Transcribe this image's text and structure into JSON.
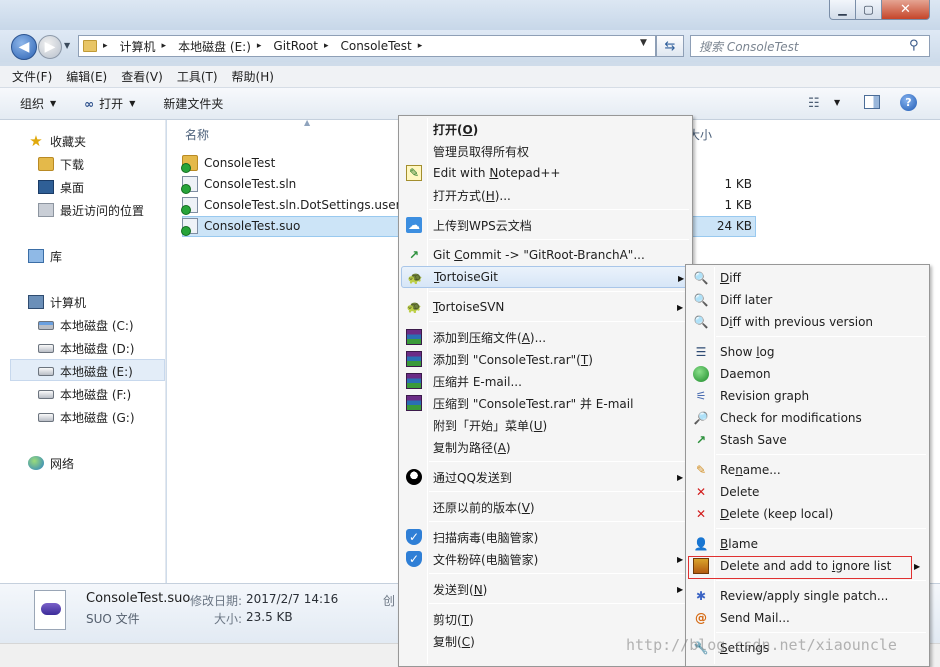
{
  "window": {
    "min_glyph": "▁",
    "max_glyph": "▢",
    "close_glyph": "✕"
  },
  "address": {
    "crumbs": [
      "计算机",
      "本地磁盘 (E:)",
      "GitRoot",
      "ConsoleTest"
    ],
    "search_placeholder": "搜索 ConsoleTest"
  },
  "menubar": {
    "items": [
      "文件(F)",
      "编辑(E)",
      "查看(V)",
      "工具(T)",
      "帮助(H)"
    ]
  },
  "toolbar": {
    "organize": "组织",
    "open": "打开",
    "new_folder": "新建文件夹"
  },
  "navpane": {
    "favorites": "收藏夹",
    "downloads": "下载",
    "desktop": "桌面",
    "recent": "最近访问的位置",
    "libraries": "库",
    "computer": "计算机",
    "drives": [
      "本地磁盘 (C:)",
      "本地磁盘 (D:)",
      "本地磁盘 (E:)",
      "本地磁盘 (F:)",
      "本地磁盘 (G:)"
    ],
    "selected_drive": "本地磁盘 (E:)",
    "network": "网络"
  },
  "filelist": {
    "col_name": "名称",
    "col_size": "大小",
    "files": [
      {
        "name": "ConsoleTest",
        "size": ""
      },
      {
        "name": "ConsoleTest.sln",
        "size": "1 KB"
      },
      {
        "name": "ConsoleTest.sln.DotSettings.user",
        "size": "1 KB"
      },
      {
        "name": "ConsoleTest.suo",
        "size": "24 KB"
      }
    ],
    "selected": "ConsoleTest.suo"
  },
  "details": {
    "name": "ConsoleTest.suo",
    "type": "SUO 文件",
    "modified_label": "修改日期:",
    "modified_value": "2017/2/7 14:16",
    "size_label": "大小:",
    "size_value": "23.5 KB",
    "created_label": "创"
  },
  "context_menu": {
    "open": {
      "pre": "打开(",
      "u": "O",
      "post": ")"
    },
    "admin": "管理员取得所有权",
    "notepad": {
      "pre": "Edit with ",
      "u": "N",
      "post": "otepad++"
    },
    "open_with": {
      "pre": "打开方式(",
      "u": "H",
      "post": ")..."
    },
    "wps": "上传到WPS云文档",
    "git_commit": {
      "pre": "Git ",
      "u": "C",
      "post": "ommit -> \"GitRoot-BranchA\"..."
    },
    "tortoisegit": {
      "pre": "",
      "u": "T",
      "post": "ortoiseGit"
    },
    "tortoisesvn": {
      "pre": "",
      "u": "T",
      "post": "ortoiseSVN"
    },
    "add_archive": {
      "pre": "添加到压缩文件(",
      "u": "A",
      "post": ")..."
    },
    "add_rar": {
      "pre": "添加到 \"ConsoleTest.rar\"(",
      "u": "T",
      "post": ")"
    },
    "compress_email": "压缩并 E-mail...",
    "compress_rar_email": "压缩到 \"ConsoleTest.rar\" 并 E-mail",
    "pin_start": {
      "pre": "附到「开始」菜单(",
      "u": "U",
      "post": ")"
    },
    "copy_path": {
      "pre": "复制为路径(",
      "u": "A",
      "post": ")"
    },
    "qq_send": "通过QQ发送到",
    "restore": {
      "pre": "还原以前的版本(",
      "u": "V",
      "post": ")"
    },
    "scan_virus": "扫描病毒(电脑管家)",
    "shred": "文件粉碎(电脑管家)",
    "send_to": {
      "pre": "发送到(",
      "u": "N",
      "post": ")"
    },
    "cut": {
      "pre": "剪切(",
      "u": "T",
      "post": ")"
    },
    "copy": {
      "pre": "复制(",
      "u": "C",
      "post": ")"
    }
  },
  "tgit_menu": {
    "diff": {
      "pre": "",
      "u": "D",
      "post": "iff"
    },
    "diff_later": "Diff later",
    "diff_prev": {
      "pre": "D",
      "u": "i",
      "post": "ff with previous version"
    },
    "show_log": {
      "pre": "Show ",
      "u": "l",
      "post": "og"
    },
    "daemon": "Daemon",
    "revision_graph": "Revision graph",
    "check_mods": "Check for modifications",
    "stash_save": "Stash Save",
    "rename": {
      "pre": "Re",
      "u": "n",
      "post": "ame..."
    },
    "delete": "Delete",
    "delete_keep": {
      "pre": "",
      "u": "D",
      "post": "elete (keep local)"
    },
    "blame": {
      "pre": "",
      "u": "B",
      "post": "lame"
    },
    "delete_ignore": {
      "pre": "Delete and add to ",
      "u": "i",
      "post": "gnore list"
    },
    "review_patch": "Review/apply single patch...",
    "send_mail": "Send Mail...",
    "settings": {
      "pre": "",
      "u": "S",
      "post": "ettings"
    }
  },
  "icons": {
    "back": "back-arrow-icon",
    "forward": "forward-arrow-icon",
    "refresh": "refresh-icon",
    "search": "search-icon",
    "help": "help-icon"
  },
  "colors": {
    "selection": "#cce4f7",
    "highlight_box": "#e03030"
  },
  "watermark": "http://blog.csdn.net/xiaouncle"
}
